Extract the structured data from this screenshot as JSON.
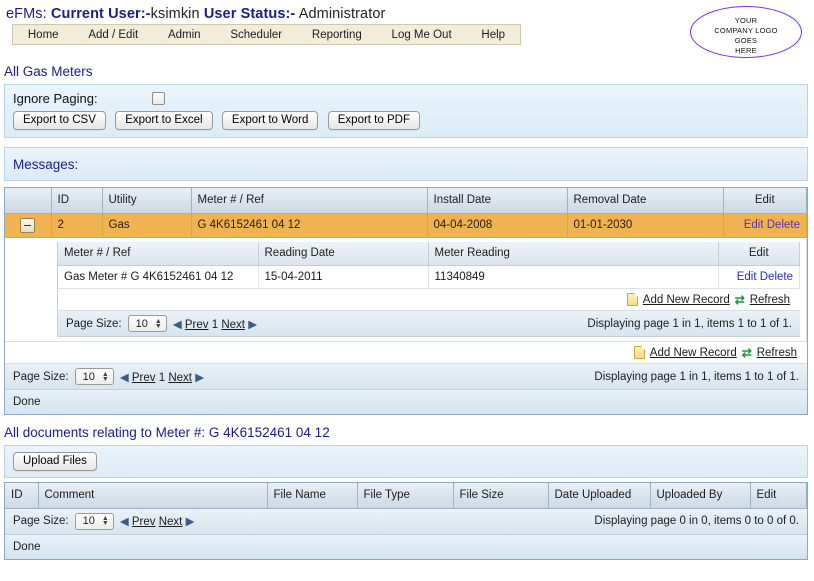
{
  "header": {
    "app_name": "eFMs:",
    "current_user_label": "Current User:-",
    "current_user": "ksimkin",
    "user_status_label": "User Status:-",
    "user_status": "Administrator",
    "logo_lines": [
      "YOUR",
      "COMPANY LOGO",
      "GOES",
      "HERE"
    ],
    "logo_color": "#7b2ff2"
  },
  "nav": {
    "items": [
      {
        "label": "Home"
      },
      {
        "label": "Add / Edit"
      },
      {
        "label": "Admin"
      },
      {
        "label": "Scheduler"
      },
      {
        "label": "Reporting"
      },
      {
        "label": "Log Me Out"
      },
      {
        "label": "Help"
      }
    ]
  },
  "meters_section": {
    "title": "All Gas Meters",
    "ignore_paging_label": "Ignore Paging:",
    "ignore_paging_checked": false,
    "export_buttons": [
      {
        "label": "Export to CSV"
      },
      {
        "label": "Export to Excel"
      },
      {
        "label": "Export to Word"
      },
      {
        "label": "Export to PDF"
      }
    ],
    "messages_label": "Messages:",
    "messages_text": ""
  },
  "meters_grid": {
    "columns": [
      "",
      "ID",
      "Utility",
      "Meter # / Ref",
      "Install Date",
      "Removal Date",
      "Edit"
    ],
    "rows": [
      {
        "expander": "minus",
        "id": "2",
        "utility": "Gas",
        "meter_ref": "G 4K6152461 04 12",
        "install_date": "04-04-2008",
        "removal_date": "01-01-2030",
        "edit": "Edit",
        "delete": "Delete",
        "selected": true
      }
    ],
    "commands": {
      "add_label": "Add New Record",
      "refresh_label": "Refresh"
    },
    "pager": {
      "page_size_label": "Page Size:",
      "page_size_value": "10",
      "prev": "Prev",
      "page": "1",
      "next": "Next",
      "status": "Displaying page 1 in 1, items 1 to 1 of 1."
    },
    "status": "Done"
  },
  "readings_grid": {
    "columns": [
      "Meter # / Ref",
      "Reading Date",
      "Meter Reading",
      "Edit"
    ],
    "rows": [
      {
        "meter_ref": "Gas Meter # G 4K6152461 04 12",
        "reading_date": "15-04-2011",
        "meter_reading": "11340849",
        "edit": "Edit",
        "delete": "Delete"
      }
    ],
    "commands": {
      "add_label": "Add New Record",
      "refresh_label": "Refresh"
    },
    "pager": {
      "page_size_label": "Page Size:",
      "page_size_value": "10",
      "prev": "Prev",
      "page": "1",
      "next": "Next",
      "status": "Displaying page 1 in 1, items 1 to 1 of 1."
    }
  },
  "documents_section": {
    "title": "All documents relating to Meter #: G 4K6152461 04 12",
    "upload_button": "Upload Files",
    "columns": [
      "ID",
      "Comment",
      "File Name",
      "File Type",
      "File Size",
      "Date Uploaded",
      "Uploaded By",
      "Edit"
    ],
    "rows": [],
    "pager": {
      "page_size_label": "Page Size:",
      "page_size_value": "10",
      "prev": "Prev",
      "next": "Next",
      "status": "Displaying page 0 in 0, items 0 to 0 of 0."
    },
    "status": "Done"
  }
}
